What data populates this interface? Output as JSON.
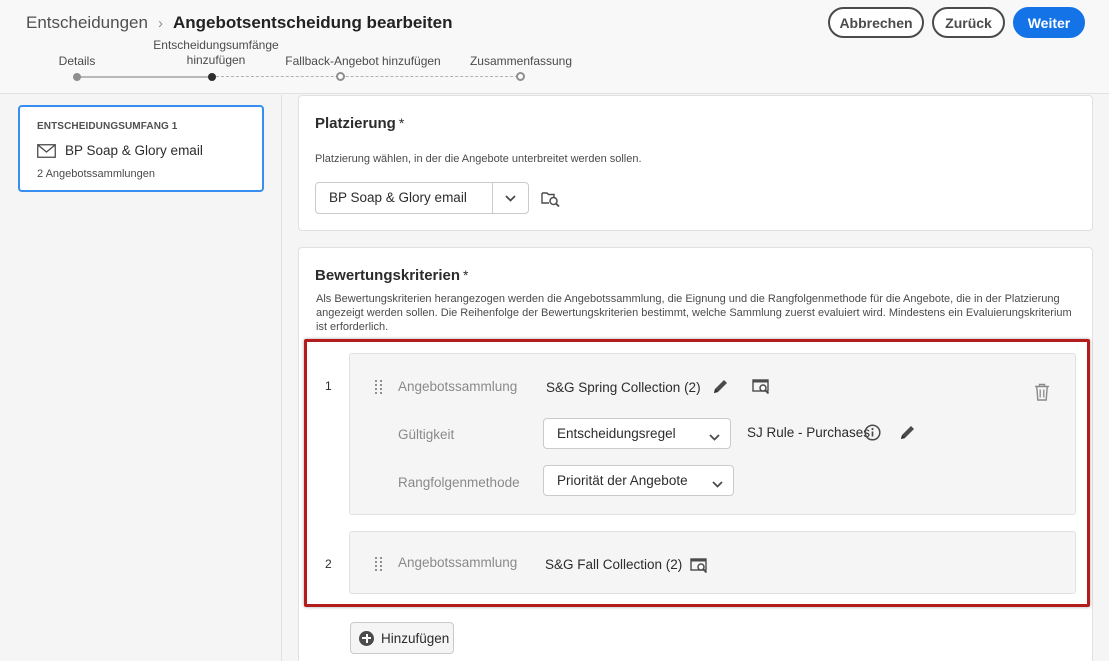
{
  "header": {
    "breadcrumb_parent": "Entscheidungen",
    "breadcrumb_separator": "›",
    "breadcrumb_current": "Angebotsentscheidung bearbeiten",
    "cancel_label": "Abbrechen",
    "back_label": "Zurück",
    "next_label": "Weiter"
  },
  "stepper": {
    "steps": [
      {
        "label": "Details",
        "state": "done"
      },
      {
        "label_line1": "Entscheidungsumfänge",
        "label_line2": "hinzufügen",
        "state": "active"
      },
      {
        "label": "Fallback-Angebot hinzufügen",
        "state": "todo"
      },
      {
        "label": "Zusammenfassung",
        "state": "todo"
      }
    ]
  },
  "sidebar": {
    "scope_title": "ENTSCHEIDUNGSUMFANG 1",
    "scope_icon": "email-icon",
    "scope_name": "BP Soap & Glory email",
    "scope_count": "2 Angebotssammlungen"
  },
  "placement": {
    "title": "Platzierung",
    "required": "*",
    "description": "Platzierung wählen, in der die Angebote unterbreitet werden sollen.",
    "selected": "BP Soap & Glory email"
  },
  "criteria": {
    "title": "Bewertungskriterien",
    "required": "*",
    "description_line1": "Als Bewertungskriterien herangezogen werden die Angebotssammlung, die Eignung und die Rangfolgenmethode für die Angebote, die in der Platzierung",
    "description_line2": "angezeigt werden sollen. Die Reihenfolge der Bewertungskriterien bestimmt, welche Sammlung zuerst evaluiert wird. Mindestens ein Evaluierungskriterium",
    "description_line3": "ist erforderlich.",
    "items": [
      {
        "number": "1",
        "collection_label": "Angebotssammlung",
        "collection_value": "S&G Spring Collection (2)",
        "eligibility_label": "Gültigkeit",
        "eligibility_type": "Entscheidungsregel",
        "eligibility_rule": "SJ Rule - Purchases",
        "ranking_label": "Rangfolgenmethode",
        "ranking_value": "Priorität der Angebote"
      },
      {
        "number": "2",
        "collection_label": "Angebotssammlung",
        "collection_value": "S&G Fall Collection (2)"
      }
    ],
    "add_label": "Hinzufügen"
  },
  "colors": {
    "primary": "#1473e6",
    "highlight": "#b21c1c",
    "selected_border": "#378ef0"
  }
}
